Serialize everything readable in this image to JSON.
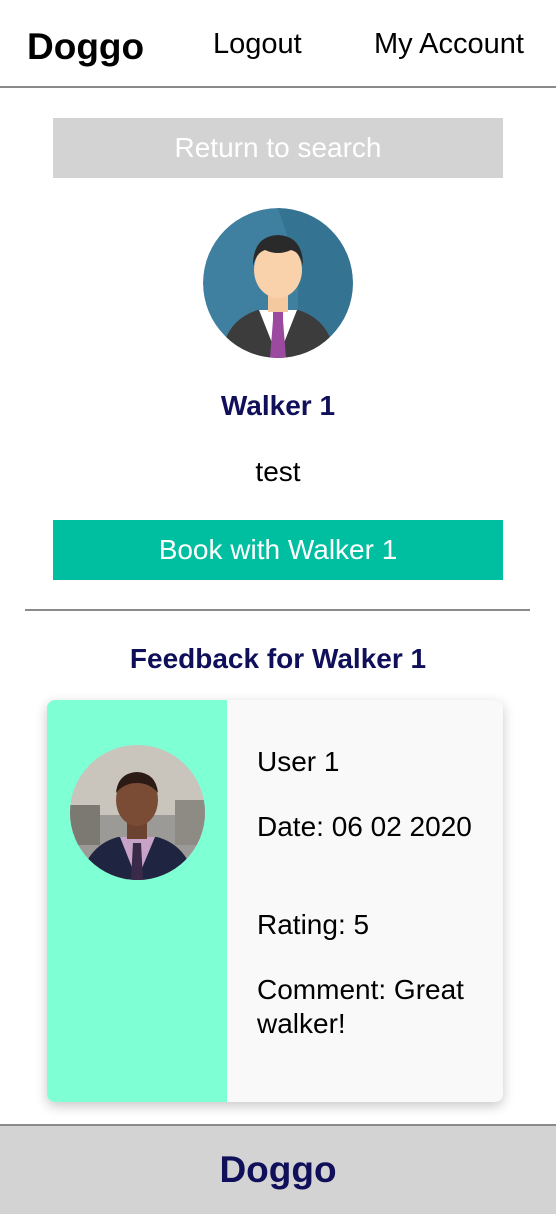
{
  "nav": {
    "brand": "Doggo",
    "logout": "Logout",
    "my_account": "My Account"
  },
  "return_button": "Return to search",
  "walker": {
    "name": "Walker 1",
    "description": "test",
    "book_button": "Book with Walker 1"
  },
  "feedback": {
    "heading": "Feedback for Walker 1",
    "items": [
      {
        "user": "User 1",
        "date": "Date: 06 02 2020",
        "rating": "Rating: 5",
        "comment": "Comment: Great walker!"
      }
    ]
  },
  "footer": {
    "brand": "Doggo"
  },
  "colors": {
    "accent": "#00bfa0",
    "heading": "#10105a",
    "card_side": "#7fffd4",
    "button_gray": "#d3d3d3"
  }
}
